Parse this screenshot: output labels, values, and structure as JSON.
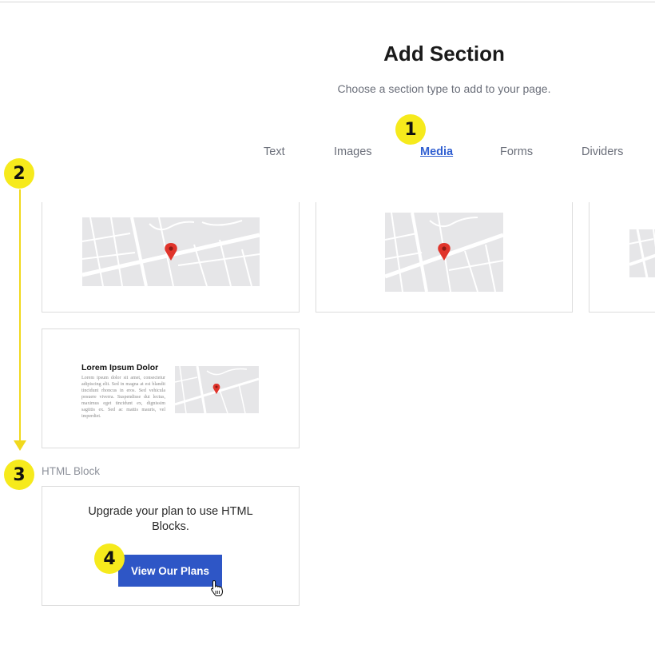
{
  "header": {
    "title": "Add Section",
    "subtitle": "Choose a section type to add to your page."
  },
  "tabs": [
    {
      "label": "Text",
      "active": false
    },
    {
      "label": "Images",
      "active": false
    },
    {
      "label": "Media",
      "active": true
    },
    {
      "label": "Forms",
      "active": false
    },
    {
      "label": "Dividers",
      "active": false
    }
  ],
  "annotations": [
    "1",
    "2",
    "3",
    "4"
  ],
  "cards": {
    "map_preview_1": {
      "icon": "map-icon"
    },
    "map_preview_2": {
      "icon": "map-icon"
    },
    "map_preview_3": {
      "icon": "map-icon"
    },
    "text_and_map": {
      "heading": "Lorem Ipsum Dolor",
      "body": "Lorem ipsum dolor sit amet, consectetur adipiscing elit. Sed in magna at est blandit tincidunt rhoncus in eros. Sed vehicula posuere viverra. Suspendisse dui lectus, maximus eget tincidunt ex, dignissim sagittis ex. Sed ac mattis mauris, vel imperdiet."
    }
  },
  "html_block": {
    "label": "HTML Block",
    "message": "Upgrade your plan to use HTML Blocks.",
    "button_label": "View Our Plans"
  },
  "colors": {
    "accent": "#2e56c6",
    "active_tab": "#2f5ed1",
    "annotation": "#f6ea1c",
    "map_pin": "#e0342b",
    "map_bg": "#e6e6e8"
  }
}
